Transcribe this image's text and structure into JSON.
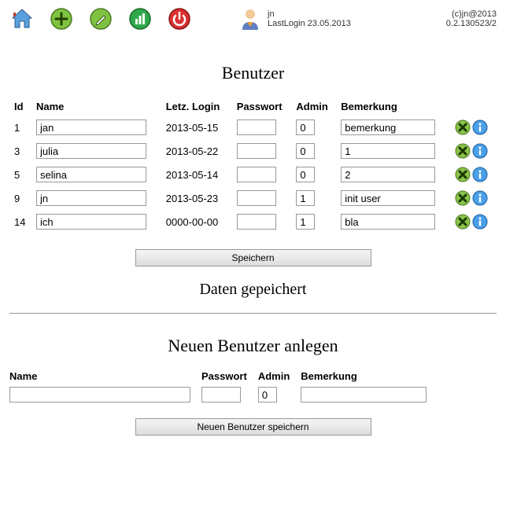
{
  "toolbar": {
    "home_icon": "home",
    "plus_icon": "plus",
    "pencil_icon": "pencil",
    "chart_icon": "chart",
    "power_icon": "power"
  },
  "user": {
    "name": "jn",
    "last_login_label": "LastLogin",
    "last_login": "23.05.2013"
  },
  "app": {
    "copyright": "(c)jn@2013",
    "version": "0.2.130523/2"
  },
  "page": {
    "title": "Benutzer",
    "save_label": "Speichern",
    "status_message": "Daten gepeichert",
    "new_user_title": "Neuen Benutzer anlegen",
    "new_user_save_label": "Neuen Benutzer speichern"
  },
  "columns": {
    "id": "Id",
    "name": "Name",
    "last_login": "Letz. Login",
    "password": "Passwort",
    "admin": "Admin",
    "remark": "Bemerkung"
  },
  "rows": [
    {
      "id": "1",
      "name": "jan",
      "last_login": "2013-05-15",
      "password": "",
      "admin": "0",
      "remark": "bemerkung"
    },
    {
      "id": "3",
      "name": "julia",
      "last_login": "2013-05-22",
      "password": "",
      "admin": "0",
      "remark": "1"
    },
    {
      "id": "5",
      "name": "selina",
      "last_login": "2013-05-14",
      "password": "",
      "admin": "0",
      "remark": "2"
    },
    {
      "id": "9",
      "name": "jn",
      "last_login": "2013-05-23",
      "password": "",
      "admin": "1",
      "remark": "init user"
    },
    {
      "id": "14",
      "name": "ich",
      "last_login": "0000-00-00",
      "password": "",
      "admin": "1",
      "remark": "bla"
    }
  ],
  "new_user": {
    "name": "",
    "password": "",
    "admin": "0",
    "remark": ""
  }
}
